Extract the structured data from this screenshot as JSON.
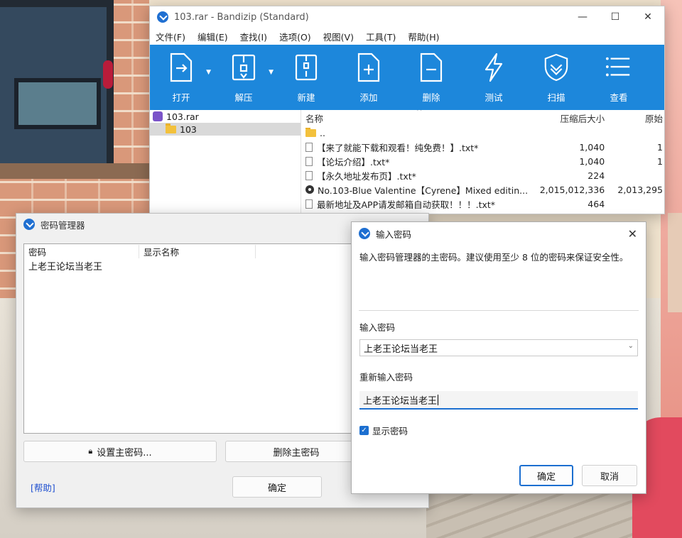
{
  "bandizip": {
    "title": "103.rar - Bandizip (Standard)",
    "controls": {
      "minimize": "—",
      "maximize": "☐",
      "close": "✕"
    },
    "menu": [
      "文件(F)",
      "编辑(E)",
      "查找(I)",
      "选项(O)",
      "视图(V)",
      "工具(T)",
      "帮助(H)"
    ],
    "toolbar": [
      {
        "label": "打开",
        "icon": "open-icon",
        "dropdown": true
      },
      {
        "label": "解压",
        "icon": "extract-icon",
        "dropdown": true
      },
      {
        "label": "新建",
        "icon": "new-archive-icon",
        "dropdown": false
      },
      {
        "label": "添加",
        "icon": "add-icon",
        "dropdown": false
      },
      {
        "label": "删除",
        "icon": "delete-icon",
        "dropdown": false
      },
      {
        "label": "测试",
        "icon": "test-icon",
        "dropdown": false
      },
      {
        "label": "扫描",
        "icon": "scan-icon",
        "dropdown": false
      },
      {
        "label": "查看",
        "icon": "view-icon",
        "dropdown": false
      }
    ],
    "tree": {
      "root": "103.rar",
      "child": "103"
    },
    "list": {
      "headers": {
        "name": "名称",
        "packed": "压缩后大小",
        "original": "原始"
      },
      "sort_indicator": "^",
      "rows": [
        {
          "icon": "folder-icon",
          "name": "..",
          "packed": "",
          "original": ""
        },
        {
          "icon": "text-file-icon",
          "name": "【来了就能下载和观看！纯免费！】.txt*",
          "packed": "1,040",
          "original": "1"
        },
        {
          "icon": "text-file-icon",
          "name": "【论坛介绍】.txt*",
          "packed": "1,040",
          "original": "1"
        },
        {
          "icon": "text-file-icon",
          "name": "【永久地址发布页】.txt*",
          "packed": "224",
          "original": ""
        },
        {
          "icon": "archive-file-icon",
          "name": "No.103-Blue Valentine【Cyrene】Mixed editin...",
          "packed": "2,015,012,336",
          "original": "2,013,295"
        },
        {
          "icon": "text-file-icon",
          "name": "最新地址及APP请发邮箱自动获取！！！.txt*",
          "packed": "464",
          "original": ""
        }
      ]
    }
  },
  "pwmgr": {
    "title": "密码管理器",
    "columns": {
      "password": "密码",
      "display_name": "显示名称"
    },
    "rows": [
      {
        "password": "上老王论坛当老王",
        "display_name": ""
      }
    ],
    "set_master_label": "设置主密码...",
    "delete_master_label": "删除主密码",
    "ok_label": "确定",
    "help_label": "[帮助]"
  },
  "pwdlg": {
    "title": "输入密码",
    "close": "✕",
    "description": "输入密码管理器的主密码。建议使用至少 8 位的密码来保证安全性。",
    "password_label": "输入密码",
    "password_value": "上老王论坛当老王",
    "reenter_label": "重新输入密码",
    "reenter_value": "上老王论坛当老王",
    "show_password_label": "显示密码",
    "show_password_checked": true,
    "ok_label": "确定",
    "cancel_label": "取消"
  },
  "colors": {
    "ribbon": "#1d87db",
    "accent": "#1c6fd0",
    "link": "#1e4fd0"
  }
}
